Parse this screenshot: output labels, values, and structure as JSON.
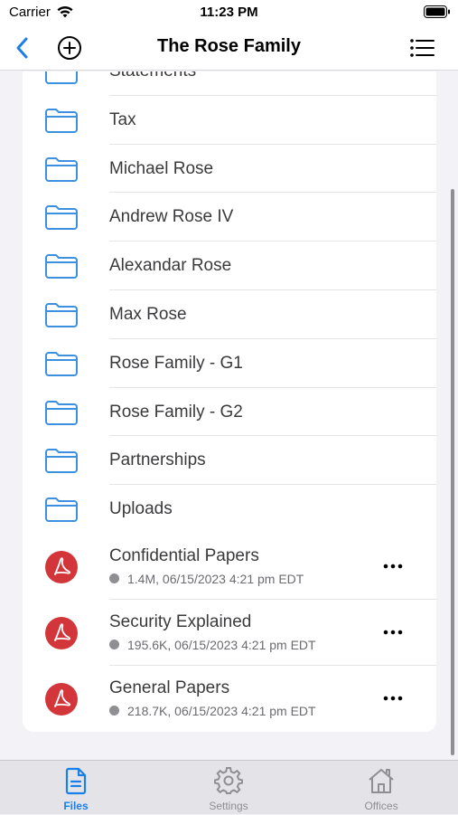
{
  "status_bar": {
    "carrier": "Carrier",
    "time": "11:23 PM"
  },
  "nav": {
    "title": "The Rose Family"
  },
  "folders": [
    {
      "name": "Statements"
    },
    {
      "name": "Tax"
    },
    {
      "name": "Michael Rose"
    },
    {
      "name": "Andrew Rose IV"
    },
    {
      "name": "Alexandar Rose"
    },
    {
      "name": "Max Rose"
    },
    {
      "name": "Rose Family - G1"
    },
    {
      "name": "Rose Family - G2"
    },
    {
      "name": "Partnerships"
    },
    {
      "name": "Uploads"
    }
  ],
  "files": [
    {
      "name": "Confidential Papers",
      "meta": "1.4M, 06/15/2023 4:21 pm EDT"
    },
    {
      "name": "Security Explained",
      "meta": "195.6K, 06/15/2023 4:21 pm EDT"
    },
    {
      "name": "General Papers",
      "meta": "218.7K, 06/15/2023 4:21 pm EDT"
    }
  ],
  "tabs": [
    {
      "label": "Files",
      "active": true,
      "icon": "document-icon"
    },
    {
      "label": "Settings",
      "active": false,
      "icon": "gear-icon"
    },
    {
      "label": "Offices",
      "active": false,
      "icon": "house-icon"
    }
  ],
  "colors": {
    "accent": "#1a7fe8",
    "folder_icon": "#3d8fe0",
    "pdf_badge": "#d2353a"
  }
}
